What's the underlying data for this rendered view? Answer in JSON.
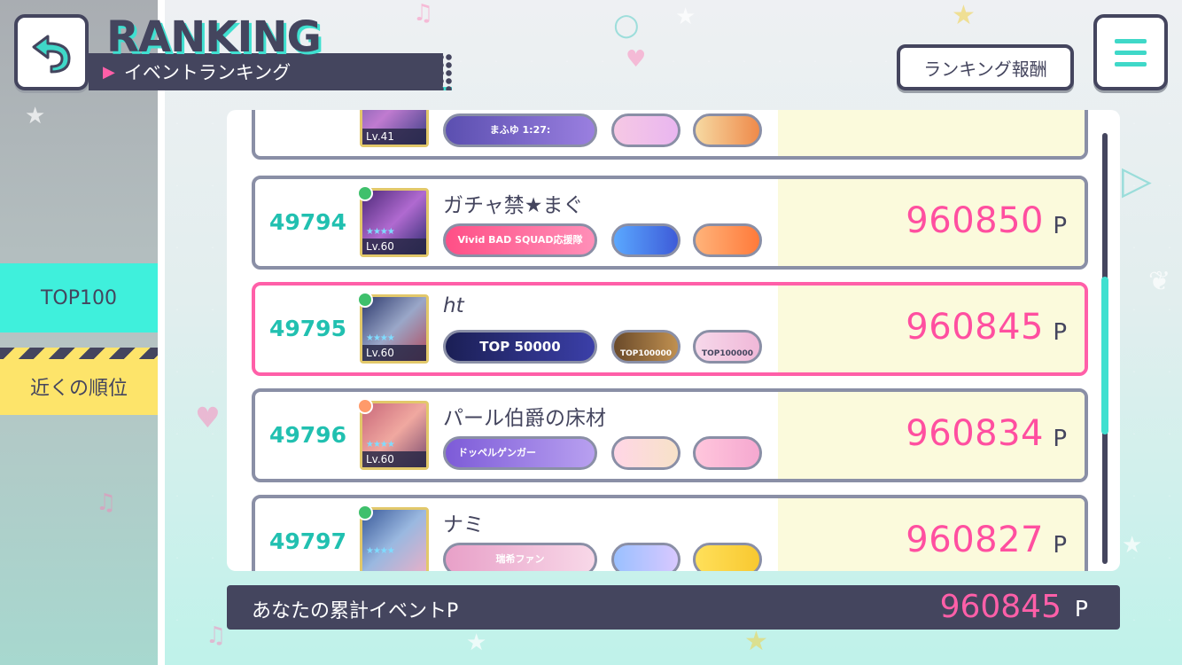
{
  "header": {
    "title": "RANKING",
    "subtitle": "イベントランキング",
    "rewards_button": "ランキング報酬"
  },
  "tabs": {
    "top100": "TOP100",
    "nearby": "近くの順位"
  },
  "rows": [
    {
      "rank": "",
      "name": "",
      "level": "Lv.41",
      "title_badge": "まふゆ 1:27:",
      "points": "",
      "unit": ""
    },
    {
      "rank": "49794",
      "name": "ガチャ禁★まぐ",
      "level": "Lv.60",
      "title_badge": "Vivid BAD SQUAD応援隊",
      "badge1": "",
      "badge2": "",
      "points": "960850",
      "unit": "P"
    },
    {
      "rank": "49795",
      "name": "ht",
      "level": "Lv.60",
      "title_badge": "TOP 50000",
      "badge1": "TOP100000",
      "badge2": "TOP100000",
      "points": "960845",
      "unit": "P"
    },
    {
      "rank": "49796",
      "name": "パール伯爵の床材",
      "level": "Lv.60",
      "title_badge": "ドッペルゲンガー",
      "badge1": "",
      "badge2": "",
      "points": "960834",
      "unit": "P"
    },
    {
      "rank": "49797",
      "name": "ナミ",
      "level": "",
      "title_badge": "瑞希ファン",
      "badge1": "",
      "badge2": "",
      "points": "960827",
      "unit": "P"
    }
  ],
  "footer": {
    "label": "あなたの累計イベントP",
    "value": "960845",
    "unit": "P"
  },
  "colors": {
    "accent_teal": "#3fe0d0",
    "accent_pink": "#ff4fa0",
    "navy": "#44455e",
    "tab_yellow": "#fde46a",
    "score_bg": "#fbfadc"
  },
  "icons": {
    "back": "back-arrow-icon",
    "menu": "hamburger-menu-icon"
  }
}
